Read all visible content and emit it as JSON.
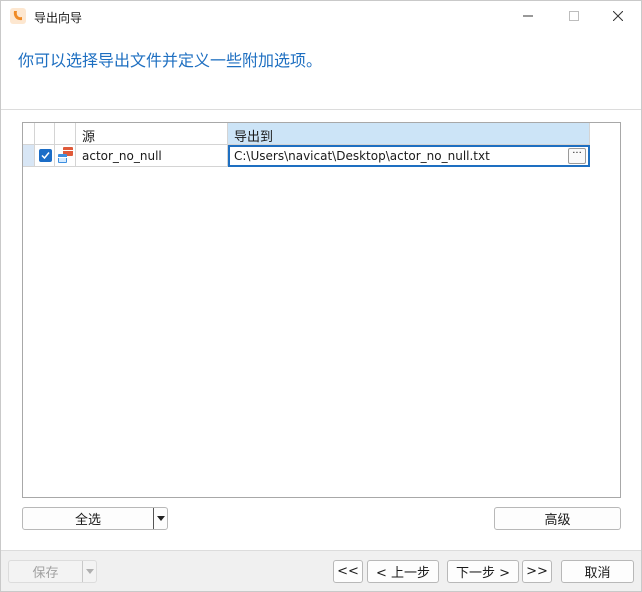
{
  "window": {
    "title": "导出向导"
  },
  "header": {
    "instruction": "你可以选择导出文件并定义一些附加选项。"
  },
  "grid": {
    "columns": {
      "source": "源",
      "export_to": "导出到"
    },
    "rows": [
      {
        "checked": true,
        "source": "actor_no_null",
        "path": "C:\\Users\\navicat\\Desktop\\actor_no_null.txt",
        "browse_label": "···"
      }
    ]
  },
  "buttons": {
    "select_all": "全选",
    "advanced": "高级",
    "save": "保存",
    "first": "<<",
    "prev": "< 上一步",
    "next": "下一步 >",
    "last": ">>",
    "cancel": "取消"
  },
  "colors": {
    "accent": "#1e6fc1",
    "checkbox": "#1b6dc7",
    "header_selected": "#cce4f7",
    "row_indicator": "#d8e6f5",
    "app_icon": "#f08a24"
  },
  "icons": {
    "app": "navicat-logo-icon",
    "table": "table-icon",
    "dropdown": "chevron-down-icon"
  }
}
